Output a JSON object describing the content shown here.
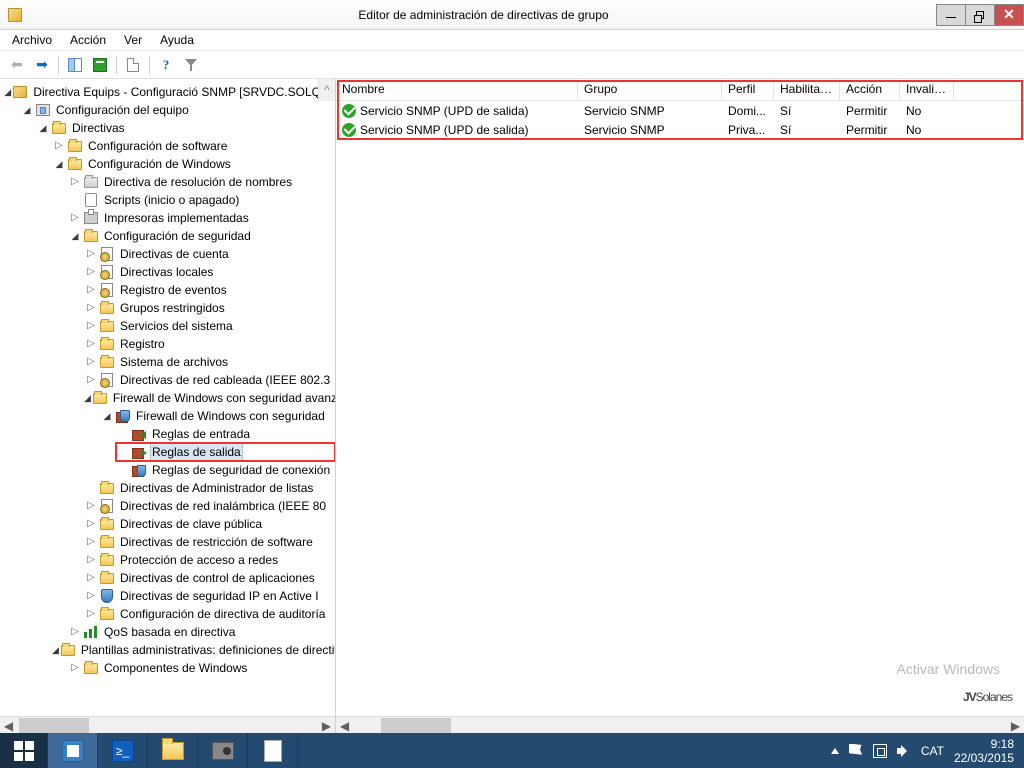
{
  "window": {
    "title": "Editor de administración de directivas de grupo"
  },
  "menu": {
    "file": "Archivo",
    "action": "Acción",
    "view": "Ver",
    "help": "Ayuda"
  },
  "tree": {
    "root": "Directiva Equips - Configuració SNMP [SRVDC.SOLQUI",
    "computer_config": "Configuración del equipo",
    "policies": "Directivas",
    "software_config": "Configuración de software",
    "windows_config": "Configuración de Windows",
    "name_res": "Directiva de resolución de nombres",
    "scripts": "Scripts (inicio o apagado)",
    "printers": "Impresoras implementadas",
    "security_config": "Configuración de seguridad",
    "account_pol": "Directivas de cuenta",
    "local_pol": "Directivas locales",
    "event_log": "Registro de eventos",
    "restricted_groups": "Grupos restringidos",
    "system_services": "Servicios del sistema",
    "registry": "Registro",
    "filesystem": "Sistema de archivos",
    "wired": "Directivas de red cableada (IEEE 802.3",
    "fw_adv": "Firewall de Windows con seguridad avanzada",
    "fw_adv_inner": "Firewall de Windows con seguridad",
    "inbound": "Reglas de entrada",
    "outbound": "Reglas de salida",
    "conn_sec": "Reglas de seguridad de conexión",
    "netlist": "Directivas de Administrador de listas",
    "wireless": "Directivas de red inalámbrica (IEEE 80",
    "pubkey": "Directivas de clave pública",
    "softrestrict": "Directivas de restricción de software",
    "nap": "Protección de acceso a redes",
    "appctrl": "Directivas de control de aplicaciones",
    "ipsec": "Directivas de seguridad IP en Active I",
    "audit": "Configuración de directiva de auditoría",
    "qos": "QoS basada en directiva",
    "admin_templates": "Plantillas administrativas: definiciones de directiva",
    "win_components": "Componentes de Windows"
  },
  "columns": {
    "name": "Nombre",
    "group": "Grupo",
    "profile": "Perfil",
    "enabled": "Habilitado",
    "action": "Acción",
    "override": "Invalidar"
  },
  "rows": [
    {
      "name": "Servicio SNMP (UPD de salida)",
      "group": "Servicio SNMP",
      "profile": "Domi...",
      "enabled": "Sí",
      "action": "Permitir",
      "override": "No"
    },
    {
      "name": "Servicio SNMP (UPD de salida)",
      "group": "Servicio SNMP",
      "profile": "Priva...",
      "enabled": "Sí",
      "action": "Permitir",
      "override": "No"
    }
  ],
  "watermark": {
    "activate": "Activar Windows",
    "brand": "JVSolanes"
  },
  "tray": {
    "lang": "CAT",
    "time": "9:18",
    "date": "22/03/2015"
  }
}
